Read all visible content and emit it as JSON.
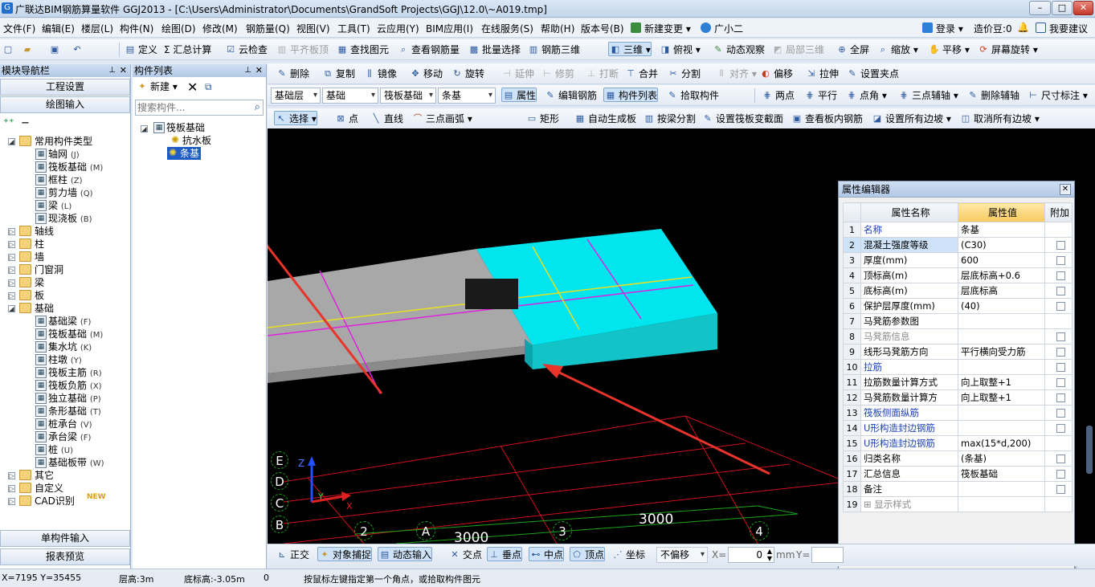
{
  "app": {
    "title": "广联达BIM钢筋算量软件 GGJ2013 - [C:\\Users\\Administrator\\Documents\\GrandSoft Projects\\GGJ\\12.0\\~A019.tmp]",
    "min_label": "–",
    "max_label": "□",
    "close_label": "✕"
  },
  "menu": {
    "items": [
      "文件(F)",
      "编辑(E)",
      "楼层(L)",
      "构件(N)",
      "绘图(D)",
      "修改(M)",
      "钢筋量(Q)",
      "视图(V)",
      "工具(T)",
      "云应用(Y)",
      "BIM应用(I)",
      "在线服务(S)",
      "帮助(H)",
      "版本号(B)",
      "新建变更 ▾",
      "广小二"
    ],
    "login": "登录 ▾",
    "coins": "造价豆:0",
    "suggest": "我要建议"
  },
  "toolbar1": {
    "items": [
      "定义",
      "Σ 汇总计算",
      "云检查",
      "平齐板顶",
      "查找图元",
      "查看钢筋量",
      "批量选择",
      "钢筋三维",
      "三维 ▾",
      "俯视 ▾",
      "动态观察",
      "局部三维",
      "全屏",
      "缩放 ▾",
      "平移 ▾",
      "屏幕旋转 ▾"
    ]
  },
  "toolbar2": {
    "items": [
      "删除",
      "复制",
      "镜像",
      "移动",
      "旋转",
      "延伸",
      "修剪",
      "打断",
      "合并",
      "分割",
      "对齐 ▾",
      "偏移",
      "拉伸",
      "设置夹点"
    ]
  },
  "toolbar3": {
    "floor": "基础层",
    "category": "基础",
    "type": "筏板基础",
    "component": "条基",
    "items": [
      "属性",
      "编辑钢筋",
      "构件列表",
      "拾取构件",
      "两点",
      "平行",
      "点角 ▾",
      "三点辅轴 ▾",
      "删除辅轴",
      "尺寸标注 ▾"
    ]
  },
  "toolbar4": {
    "items": [
      "选择 ▾",
      "点",
      "直线",
      "三点画弧 ▾",
      "矩形",
      "自动生成板",
      "按梁分割",
      "设置筏板变截面",
      "查看板内钢筋",
      "设置所有边坡 ▾",
      "取消所有边坡 ▾"
    ]
  },
  "nav_panel": {
    "title": "模块导航栏",
    "project_settings": "工程设置",
    "drawing_input": "绘图输入",
    "single_input": "单构件输入",
    "report_preview": "报表预览",
    "common_group": "常用构件类型",
    "common_items": [
      {
        "label": "轴网",
        "key": "(J)"
      },
      {
        "label": "筏板基础",
        "key": "(M)"
      },
      {
        "label": "框柱",
        "key": "(Z)"
      },
      {
        "label": "剪力墙",
        "key": "(Q)"
      },
      {
        "label": "梁",
        "key": "(L)"
      },
      {
        "label": "现浇板",
        "key": "(B)"
      }
    ],
    "groups": [
      "轴线",
      "柱",
      "墙",
      "门窗洞",
      "梁",
      "板"
    ],
    "foundation_group": "基础",
    "foundation_items": [
      {
        "label": "基础梁",
        "key": "(F)"
      },
      {
        "label": "筏板基础",
        "key": "(M)"
      },
      {
        "label": "集水坑",
        "key": "(K)"
      },
      {
        "label": "柱墩",
        "key": "(Y)"
      },
      {
        "label": "筏板主筋",
        "key": "(R)"
      },
      {
        "label": "筏板负筋",
        "key": "(X)"
      },
      {
        "label": "独立基础",
        "key": "(P)"
      },
      {
        "label": "条形基础",
        "key": "(T)"
      },
      {
        "label": "桩承台",
        "key": "(V)"
      },
      {
        "label": "承台梁",
        "key": "(F)"
      },
      {
        "label": "桩",
        "key": "(U)"
      },
      {
        "label": "基础板带",
        "key": "(W)"
      }
    ],
    "other_groups": [
      "其它",
      "自定义",
      "CAD识别"
    ],
    "new_badge": "NEW"
  },
  "component_list": {
    "title": "构件列表",
    "new_button": "新建 ▾",
    "search_placeholder": "搜索构件...",
    "root": "筏板基础",
    "children": [
      "抗水板",
      "条基"
    ]
  },
  "viewport": {
    "dim_label": "3000",
    "dim_label2": "3000",
    "axis_letters": [
      "E",
      "D",
      "C",
      "B"
    ],
    "axis_numbers": [
      "2",
      "A",
      "3",
      "4"
    ],
    "axis_z": "Z",
    "axis_y": "Y",
    "axis_x": "X"
  },
  "snapbar": {
    "items": [
      "正交",
      "对象捕捉",
      "动态输入",
      "交点",
      "垂点",
      "中点",
      "顶点",
      "坐标"
    ],
    "offset_mode": "不偏移",
    "x_label": "X=",
    "x_value": "0",
    "unit": "mm",
    "y_label": "Y="
  },
  "status": {
    "coords": "X=7195 Y=35455",
    "floor_height": "层高:3m",
    "bottom_elev": "底标高:-3.05m",
    "count": "0",
    "hint": "按鼠标左键指定第一个角点，或拾取构件图元"
  },
  "prop_editor": {
    "title": "属性编辑器",
    "col_name": "属性名称",
    "col_value": "属性值",
    "col_extra": "附加",
    "rows": [
      {
        "no": "1",
        "name": "名称",
        "value": "条基",
        "style": "blue",
        "cb": false
      },
      {
        "no": "2",
        "name": "混凝土强度等级",
        "value": "(C30)",
        "style": "",
        "cb": true
      },
      {
        "no": "3",
        "name": "厚度(mm)",
        "value": "600",
        "style": "",
        "cb": true
      },
      {
        "no": "4",
        "name": "顶标高(m)",
        "value": "层底标高+0.6",
        "style": "",
        "cb": true
      },
      {
        "no": "5",
        "name": "底标高(m)",
        "value": "层底标高",
        "style": "",
        "cb": true
      },
      {
        "no": "6",
        "name": "保护层厚度(mm)",
        "value": "(40)",
        "style": "",
        "cb": true
      },
      {
        "no": "7",
        "name": "马凳筋参数图",
        "value": "",
        "style": "",
        "cb": false
      },
      {
        "no": "8",
        "name": "马凳筋信息",
        "value": "",
        "style": "gray",
        "cb": true
      },
      {
        "no": "9",
        "name": "线形马凳筋方向",
        "value": "平行横向受力筋",
        "style": "",
        "cb": true
      },
      {
        "no": "10",
        "name": "拉筋",
        "value": "",
        "style": "blue",
        "cb": true
      },
      {
        "no": "11",
        "name": "拉筋数量计算方式",
        "value": "向上取整+1",
        "style": "",
        "cb": true
      },
      {
        "no": "12",
        "name": "马凳筋数量计算方",
        "value": "向上取整+1",
        "style": "",
        "cb": true
      },
      {
        "no": "13",
        "name": "筏板侧面纵筋",
        "value": "",
        "style": "blue",
        "cb": true
      },
      {
        "no": "14",
        "name": "U形构造封边钢筋",
        "value": "",
        "style": "blue",
        "cb": true
      },
      {
        "no": "15",
        "name": "U形构造封边钢筋",
        "value": "max(15*d,200)",
        "style": "blue",
        "cb": false
      },
      {
        "no": "16",
        "name": "归类名称",
        "value": "(条基)",
        "style": "",
        "cb": true
      },
      {
        "no": "17",
        "name": "汇总信息",
        "value": "筏板基础",
        "style": "",
        "cb": true
      },
      {
        "no": "18",
        "name": "备注",
        "value": "",
        "style": "",
        "cb": true
      },
      {
        "no": "19",
        "name": "⊞ 显示样式",
        "value": "",
        "style": "gray",
        "cb": false
      }
    ]
  },
  "colors": {
    "accent": "#1f6fd0",
    "arrow": "#e8342a",
    "cyan_slab": "#00e5ee",
    "gray_strip": "#a8a8a8",
    "grid_red": "#d0101a",
    "grid_green": "#1aa31a"
  }
}
